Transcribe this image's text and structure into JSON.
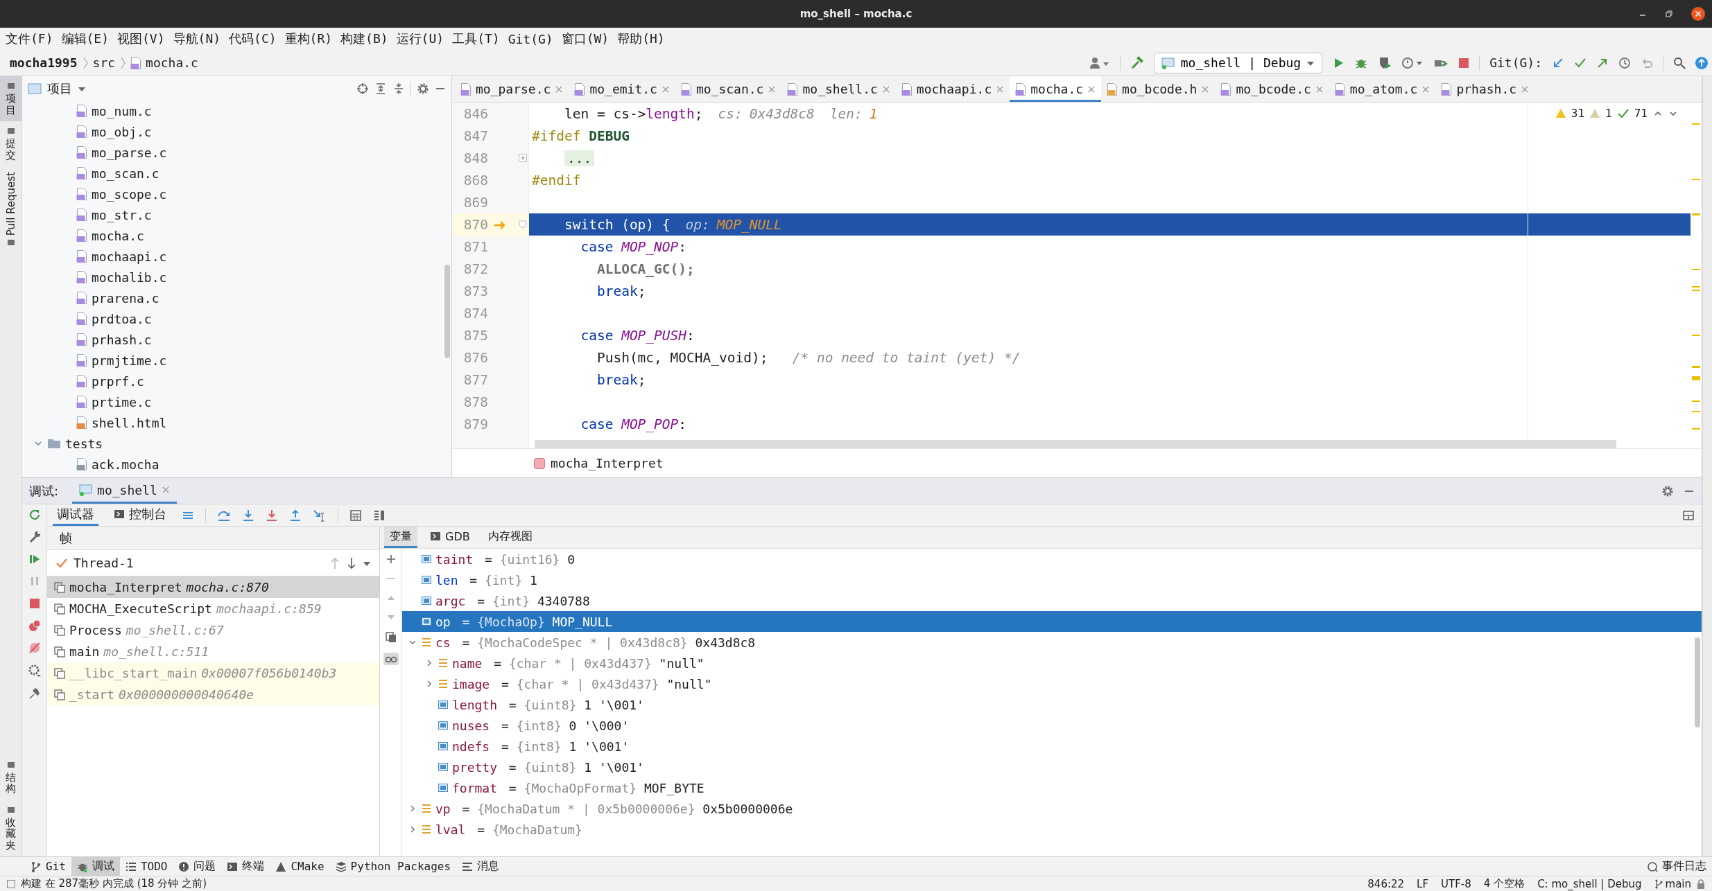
{
  "window": {
    "title": "mo_shell – mocha.c"
  },
  "menu": [
    "文件(F)",
    "编辑(E)",
    "视图(V)",
    "导航(N)",
    "代码(C)",
    "重构(R)",
    "构建(B)",
    "运行(U)",
    "工具(T)",
    "Git(G)",
    "窗口(W)",
    "帮助(H)"
  ],
  "navigation": {
    "breadcrumb": [
      {
        "text": "mocha1995",
        "kind": "project"
      },
      {
        "text": "src",
        "kind": "folder"
      },
      {
        "text": "mocha.c",
        "kind": "file"
      }
    ],
    "run_config": "mo_shell | Debug",
    "git_label": "Git(G):"
  },
  "tool_strip_left": {
    "top": [
      {
        "label": "项目",
        "selected": true
      },
      {
        "label": "提交",
        "selected": false
      },
      {
        "label": "Pull Request",
        "selected": false
      }
    ],
    "bottom": [
      {
        "label": "结构",
        "selected": false
      },
      {
        "label": "收藏夹",
        "selected": false
      }
    ]
  },
  "project": {
    "title": "项目",
    "src_files": [
      {
        "name": "mo_num.c",
        "kind": "c"
      },
      {
        "name": "mo_obj.c",
        "kind": "c"
      },
      {
        "name": "mo_parse.c",
        "kind": "c"
      },
      {
        "name": "mo_scan.c",
        "kind": "c"
      },
      {
        "name": "mo_scope.c",
        "kind": "c"
      },
      {
        "name": "mo_str.c",
        "kind": "c"
      },
      {
        "name": "mocha.c",
        "kind": "c"
      },
      {
        "name": "mochaapi.c",
        "kind": "c"
      },
      {
        "name": "mochalib.c",
        "kind": "c"
      },
      {
        "name": "prarena.c",
        "kind": "c"
      },
      {
        "name": "prdtoa.c",
        "kind": "c"
      },
      {
        "name": "prhash.c",
        "kind": "c"
      },
      {
        "name": "prmjtime.c",
        "kind": "c"
      },
      {
        "name": "prprf.c",
        "kind": "c"
      },
      {
        "name": "prtime.c",
        "kind": "c"
      },
      {
        "name": "shell.html",
        "kind": "html"
      }
    ],
    "folders": [
      {
        "name": "tests",
        "expanded": true,
        "children": [
          {
            "name": "ack.mocha",
            "kind": "text"
          }
        ]
      }
    ]
  },
  "editor": {
    "tabs": [
      {
        "name": "mo_parse.c",
        "kind": "c",
        "selected": false
      },
      {
        "name": "mo_emit.c",
        "kind": "c",
        "selected": false
      },
      {
        "name": "mo_scan.c",
        "kind": "c",
        "selected": false
      },
      {
        "name": "mo_shell.c",
        "kind": "c",
        "selected": false
      },
      {
        "name": "mochaapi.c",
        "kind": "c",
        "selected": false
      },
      {
        "name": "mocha.c",
        "kind": "c",
        "selected": true
      },
      {
        "name": "mo_bcode.h",
        "kind": "h",
        "selected": false
      },
      {
        "name": "mo_bcode.c",
        "kind": "c",
        "selected": false
      },
      {
        "name": "mo_atom.c",
        "kind": "c",
        "selected": false
      },
      {
        "name": "prhash.c",
        "kind": "c",
        "selected": false
      }
    ],
    "inspections": {
      "warnings": "31",
      "weak_warnings": "1",
      "passed": "71"
    },
    "lines": [
      {
        "number": "846",
        "current": false,
        "code": [
          {
            "kind": "plain",
            "text": "    len = cs->"
          },
          {
            "kind": "field",
            "text": "length"
          },
          {
            "kind": "plain",
            "text": ";"
          }
        ],
        "hints": [
          {
            "label": "cs:",
            "value": "0x43d8c8",
            "kind": "pointer"
          },
          {
            "label": "len:",
            "value": "1",
            "kind": "number"
          }
        ]
      },
      {
        "number": "847",
        "current": false,
        "code": [
          {
            "kind": "directive",
            "text": "#ifdef "
          },
          {
            "kind": "macro_name",
            "text": "DEBUG"
          }
        ]
      },
      {
        "number": "848",
        "current": false,
        "collapsed": true,
        "folded": "..."
      },
      {
        "number": "868",
        "current": false,
        "code": [
          {
            "kind": "directive",
            "text": "#endif"
          }
        ]
      },
      {
        "number": "869",
        "current": false
      },
      {
        "number": "870",
        "current": true,
        "collapsed": false,
        "code": [
          {
            "kind": "plain",
            "text": "    switch (op) {"
          }
        ],
        "hints": [
          {
            "label": "op:",
            "value": "MOP_NULL",
            "kind": "enum"
          }
        ]
      },
      {
        "number": "871",
        "current": false,
        "code": [
          {
            "kind": "keyword",
            "text": "      case "
          },
          {
            "kind": "enum",
            "text": "MOP_NOP"
          },
          {
            "kind": "plain",
            "text": ":"
          }
        ]
      },
      {
        "number": "872",
        "current": false,
        "code": [
          {
            "kind": "macro_call",
            "text": "        ALLOCA_GC();"
          }
        ]
      },
      {
        "number": "873",
        "current": false,
        "code": [
          {
            "kind": "keyword",
            "text": "        break"
          },
          {
            "kind": "plain",
            "text": ";"
          }
        ]
      },
      {
        "number": "874",
        "current": false
      },
      {
        "number": "875",
        "current": false,
        "code": [
          {
            "kind": "keyword",
            "text": "      case "
          },
          {
            "kind": "enum",
            "text": "MOP_PUSH"
          },
          {
            "kind": "plain",
            "text": ":"
          }
        ]
      },
      {
        "number": "876",
        "current": false,
        "code": [
          {
            "kind": "plain",
            "text": "        Push(mc, MOCHA_void);   "
          },
          {
            "kind": "comment",
            "text": "/* no need to taint (yet) */"
          }
        ]
      },
      {
        "number": "877",
        "current": false,
        "code": [
          {
            "kind": "keyword",
            "text": "        break"
          },
          {
            "kind": "plain",
            "text": ";"
          }
        ]
      },
      {
        "number": "878",
        "current": false
      },
      {
        "number": "879",
        "current": false,
        "code": [
          {
            "kind": "keyword",
            "text": "      case "
          },
          {
            "kind": "enum",
            "text": "MOP_POP"
          },
          {
            "kind": "plain",
            "text": ":"
          }
        ]
      }
    ],
    "breadcrumb_function": "mocha_Interpret"
  },
  "debug": {
    "label": "调试:",
    "session_tab": {
      "title": "mo_shell",
      "selected": true
    },
    "tabs": [
      {
        "label": "调试器",
        "kind": "debugger",
        "selected": true
      },
      {
        "label": "控制台",
        "kind": "console",
        "selected": false
      }
    ],
    "frames_header": "帧",
    "thread": "Thread-1",
    "frames": [
      {
        "function": "mocha_Interpret",
        "location": "mocha.c:870",
        "kind": "source",
        "selected": true
      },
      {
        "function": "MOCHA_ExecuteScript",
        "location": "mochaapi.c:859",
        "kind": "source",
        "selected": false
      },
      {
        "function": "Process",
        "location": "mo_shell.c:67",
        "kind": "source",
        "selected": false
      },
      {
        "function": "main",
        "location": "mo_shell.c:511",
        "kind": "source",
        "selected": false
      },
      {
        "function": "__libc_start_main",
        "location": "0x00007f056b0140b3",
        "kind": "library",
        "selected": false
      },
      {
        "function": "_start",
        "location": "0x000000000040640e",
        "kind": "library",
        "selected": false
      }
    ],
    "variable_tabs": [
      {
        "label": "变量",
        "kind": "plain",
        "selected": true
      },
      {
        "label": "GDB",
        "kind": "console",
        "selected": false
      },
      {
        "label": "内存视图",
        "kind": "plain",
        "selected": false
      }
    ],
    "variables": [
      {
        "name": "taint",
        "op": "=",
        "type": "{uint16}",
        "value": "0",
        "kind": "primitive",
        "changed": false,
        "selected": false
      },
      {
        "name": "len",
        "op": "=",
        "type": "{int}",
        "value": "1",
        "kind": "primitive",
        "changed": true,
        "selected": false
      },
      {
        "name": "argc",
        "op": "=",
        "type": "{int}",
        "value": "4340788",
        "kind": "primitive",
        "changed": false,
        "selected": false
      },
      {
        "name": "op",
        "op": "=",
        "type": "{MochaOp}",
        "value": "MOP_NULL",
        "kind": "primitive",
        "changed": false,
        "selected": true
      },
      {
        "name": "cs",
        "op": "=",
        "type": "{MochaCodeSpec * | 0x43d8c8}",
        "value": "0x43d8c8",
        "kind": "struct",
        "expanded": true,
        "changed": false,
        "selected": false,
        "children": [
          {
            "name": "name",
            "op": "=",
            "type": "{char * | 0x43d437}",
            "value": "\"null\"",
            "kind": "struct",
            "expanded": false,
            "changed": false,
            "selected": false
          },
          {
            "name": "image",
            "op": "=",
            "type": "{char * | 0x43d437}",
            "value": "\"null\"",
            "kind": "struct",
            "expanded": false,
            "changed": false,
            "selected": false
          },
          {
            "name": "length",
            "op": "=",
            "type": "{uint8}",
            "value": "1 '\\001'",
            "kind": "primitive",
            "changed": false,
            "selected": false
          },
          {
            "name": "nuses",
            "op": "=",
            "type": "{int8}",
            "value": "0 '\\000'",
            "kind": "primitive",
            "changed": false,
            "selected": false
          },
          {
            "name": "ndefs",
            "op": "=",
            "type": "{int8}",
            "value": "1 '\\001'",
            "kind": "primitive",
            "changed": false,
            "selected": false
          },
          {
            "name": "pretty",
            "op": "=",
            "type": "{uint8}",
            "value": "1 '\\001'",
            "kind": "primitive",
            "changed": false,
            "selected": false
          },
          {
            "name": "format",
            "op": "=",
            "type": "{MochaOpFormat}",
            "value": "MOF_BYTE",
            "kind": "primitive",
            "changed": false,
            "selected": false
          }
        ]
      },
      {
        "name": "vp",
        "op": "=",
        "type": "{MochaDatum * | 0x5b0000006e}",
        "value": "0x5b0000006e",
        "kind": "struct",
        "expanded": false,
        "changed": false,
        "selected": false
      },
      {
        "name": "lval",
        "op": "=",
        "type": "{MochaDatum}",
        "kind": "struct",
        "expanded": false,
        "changed": false,
        "selected": false
      }
    ]
  },
  "bottom_tools": {
    "items": [
      {
        "label": "Git",
        "kind": "git",
        "selected": false
      },
      {
        "label": "调试",
        "kind": "debug",
        "selected": true
      },
      {
        "label": "TODO",
        "kind": "todo",
        "selected": false
      },
      {
        "label": "问题",
        "kind": "problems",
        "selected": false
      },
      {
        "label": "终端",
        "kind": "terminal",
        "selected": false
      },
      {
        "label": "CMake",
        "kind": "cmake",
        "selected": false
      },
      {
        "label": "Python Packages",
        "kind": "packages",
        "selected": false
      },
      {
        "label": "消息",
        "kind": "messages",
        "selected": false
      }
    ],
    "event_log": "事件日志"
  },
  "status": {
    "message": "构建 在 287毫秒 内完成 (18 分钟 之前)",
    "items": [
      {
        "text": "846:22",
        "kind": "text"
      },
      {
        "text": "LF",
        "kind": "text"
      },
      {
        "text": "UTF-8",
        "kind": "text"
      },
      {
        "text": "4 个空格",
        "kind": "text"
      },
      {
        "text": "C: mo_shell | Debug",
        "kind": "text"
      },
      {
        "text": "main",
        "kind": "branch"
      }
    ]
  }
}
